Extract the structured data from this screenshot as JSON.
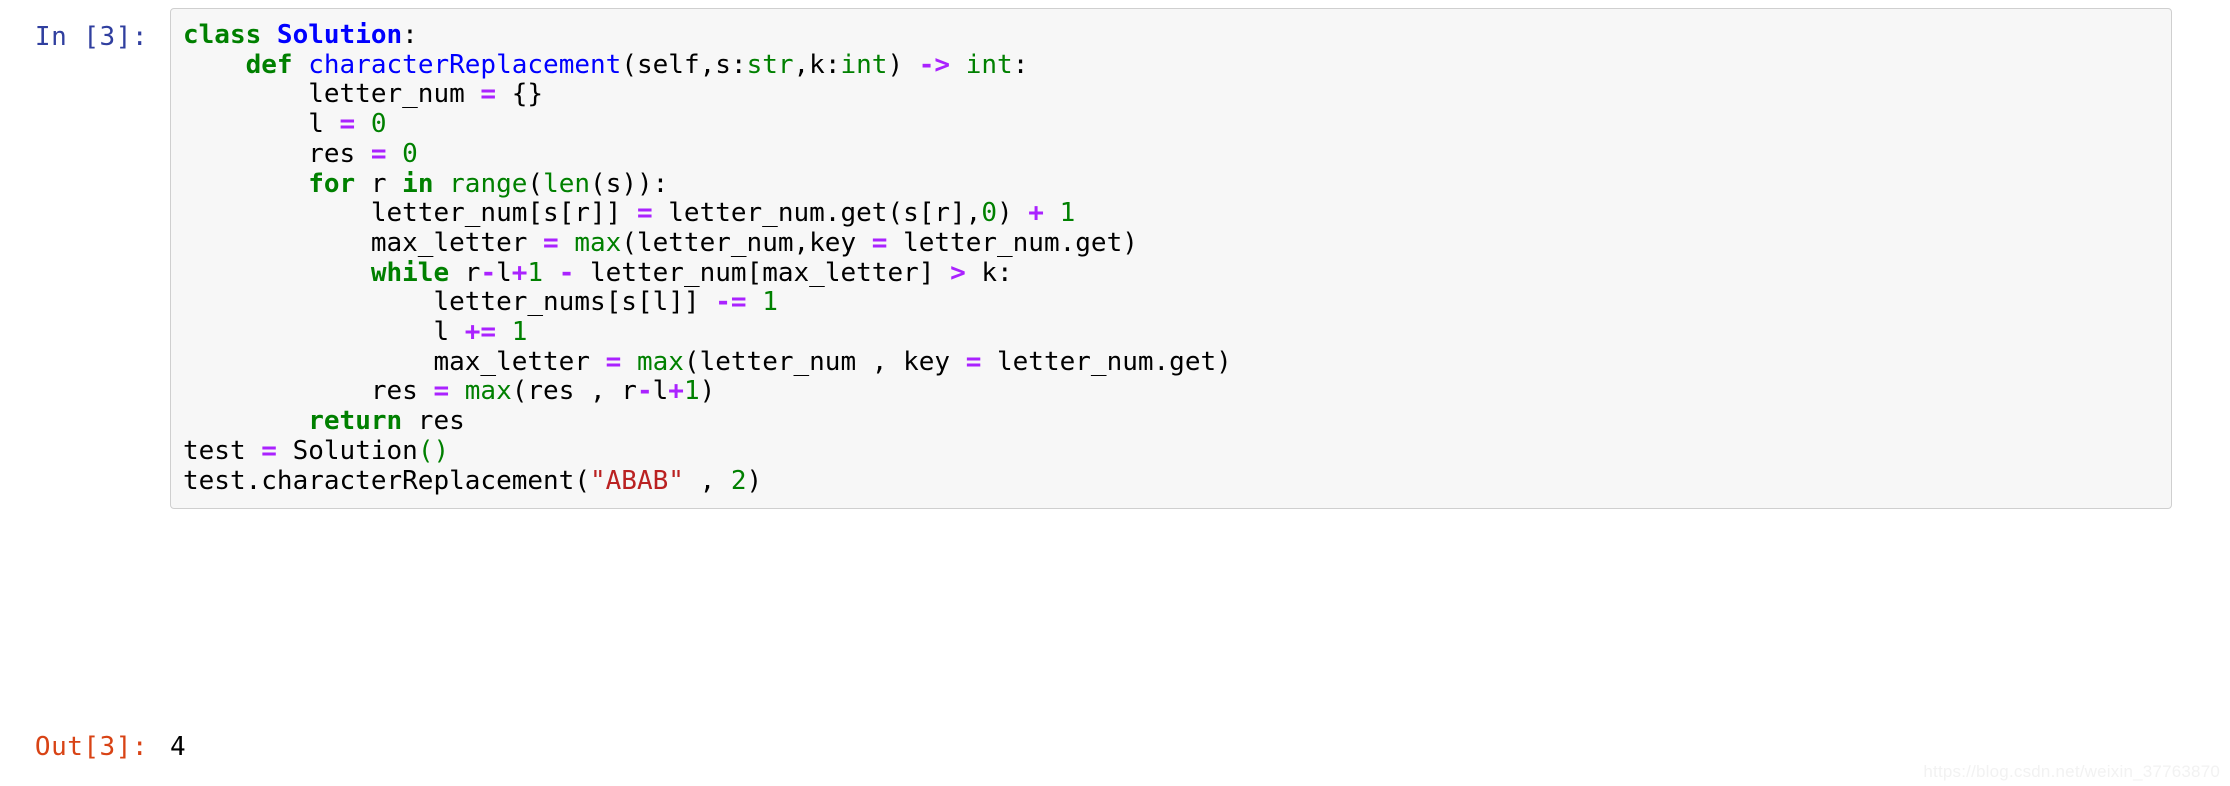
{
  "notebook": {
    "input_cell": {
      "prompt": "In [3]:",
      "prompt_color": "#303F9F",
      "background": "#f7f7f7",
      "border_color": "#cfcfcf",
      "language": "python",
      "code_lines": [
        "class Solution:",
        "    def characterReplacement(self,s:str,k:int) -> int:",
        "        letter_num = {}",
        "        l = 0",
        "        res = 0",
        "        for r in range(len(s)):",
        "            letter_num[s[r]] = letter_num.get(s[r],0) + 1",
        "            max_letter = max(letter_num,key = letter_num.get)",
        "            while r-l+1 - letter_num[max_letter] > k:",
        "                letter_nums[s[l]] -= 1",
        "                l += 1",
        "                max_letter = max(letter_num , key = letter_num.get)",
        "            res = max(res , r-l+1)",
        "        return res",
        "test = Solution()",
        "test.characterReplacement(\"ABAB\" , 2)"
      ],
      "tokens": [
        [
          [
            "class ",
            "k"
          ],
          [
            "Solution",
            "nc"
          ],
          [
            ":",
            "p"
          ]
        ],
        [
          [
            "    ",
            "p"
          ],
          [
            "def ",
            "k"
          ],
          [
            "characterReplacement",
            "nf"
          ],
          [
            "(self,s:",
            "p"
          ],
          [
            "str",
            "nb"
          ],
          [
            ",k:",
            "p"
          ],
          [
            "int",
            "nb"
          ],
          [
            ")",
            "p"
          ],
          [
            " -> ",
            "o"
          ],
          [
            "int",
            "nb"
          ],
          [
            ":",
            "p"
          ]
        ],
        [
          [
            "        letter_num ",
            "p"
          ],
          [
            "=",
            "o"
          ],
          [
            " {}",
            "p"
          ]
        ],
        [
          [
            "        l ",
            "p"
          ],
          [
            "=",
            "o"
          ],
          [
            " ",
            "p"
          ],
          [
            "0",
            "mi"
          ]
        ],
        [
          [
            "        res ",
            "p"
          ],
          [
            "=",
            "o"
          ],
          [
            " ",
            "p"
          ],
          [
            "0",
            "mi"
          ]
        ],
        [
          [
            "        ",
            "p"
          ],
          [
            "for",
            "k"
          ],
          [
            " r ",
            "p"
          ],
          [
            "in",
            "k"
          ],
          [
            " ",
            "p"
          ],
          [
            "range",
            "nb"
          ],
          [
            "(",
            "p"
          ],
          [
            "len",
            "nb"
          ],
          [
            "(s)):",
            "p"
          ]
        ],
        [
          [
            "            letter_num[s[r]] ",
            "p"
          ],
          [
            "=",
            "o"
          ],
          [
            " letter_num.get(s[r],",
            "p"
          ],
          [
            "0",
            "mi"
          ],
          [
            ")",
            "p"
          ],
          [
            " + ",
            "o"
          ],
          [
            "1",
            "mi"
          ]
        ],
        [
          [
            "            max_letter ",
            "p"
          ],
          [
            "=",
            "o"
          ],
          [
            " ",
            "p"
          ],
          [
            "max",
            "nb"
          ],
          [
            "(letter_num,key ",
            "p"
          ],
          [
            "=",
            "o"
          ],
          [
            " letter_num.get)",
            "p"
          ]
        ],
        [
          [
            "            ",
            "p"
          ],
          [
            "while",
            "k"
          ],
          [
            " r",
            "p"
          ],
          [
            "-",
            "o"
          ],
          [
            "l",
            "p"
          ],
          [
            "+",
            "o"
          ],
          [
            "1",
            "mi"
          ],
          [
            " ",
            "p"
          ],
          [
            "-",
            "o"
          ],
          [
            " letter_num[max_letter] ",
            "p"
          ],
          [
            ">",
            "o"
          ],
          [
            " k:",
            "p"
          ]
        ],
        [
          [
            "                letter_nums[s[l]] ",
            "p"
          ],
          [
            "-=",
            "o"
          ],
          [
            " ",
            "p"
          ],
          [
            "1",
            "mi"
          ]
        ],
        [
          [
            "                l ",
            "p"
          ],
          [
            "+=",
            "o"
          ],
          [
            " ",
            "p"
          ],
          [
            "1",
            "mi"
          ]
        ],
        [
          [
            "                max_letter ",
            "p"
          ],
          [
            "=",
            "o"
          ],
          [
            " ",
            "p"
          ],
          [
            "max",
            "nb"
          ],
          [
            "(letter_num , key ",
            "p"
          ],
          [
            "=",
            "o"
          ],
          [
            " letter_num.get)",
            "p"
          ]
        ],
        [
          [
            "            res ",
            "p"
          ],
          [
            "=",
            "o"
          ],
          [
            " ",
            "p"
          ],
          [
            "max",
            "nb"
          ],
          [
            "(res , r",
            "p"
          ],
          [
            "-",
            "o"
          ],
          [
            "l",
            "p"
          ],
          [
            "+",
            "o"
          ],
          [
            "1",
            "mi"
          ],
          [
            ")",
            "p"
          ]
        ],
        [
          [
            "        ",
            "p"
          ],
          [
            "return",
            "k"
          ],
          [
            " res",
            "p"
          ]
        ],
        [
          [
            "test ",
            "p"
          ],
          [
            "=",
            "o"
          ],
          [
            " Solution",
            "p"
          ],
          [
            "()",
            "gp"
          ]
        ],
        [
          [
            "test.characterReplacement(",
            "p"
          ],
          [
            "\"ABAB\"",
            "s"
          ],
          [
            " , ",
            "p"
          ],
          [
            "2",
            "mi"
          ],
          [
            ")",
            "p"
          ]
        ]
      ]
    },
    "output_cell": {
      "prompt": "Out[3]:",
      "prompt_color": "#D84315",
      "value": "4"
    },
    "watermark": "https://blog.csdn.net/weixin_37763870"
  }
}
